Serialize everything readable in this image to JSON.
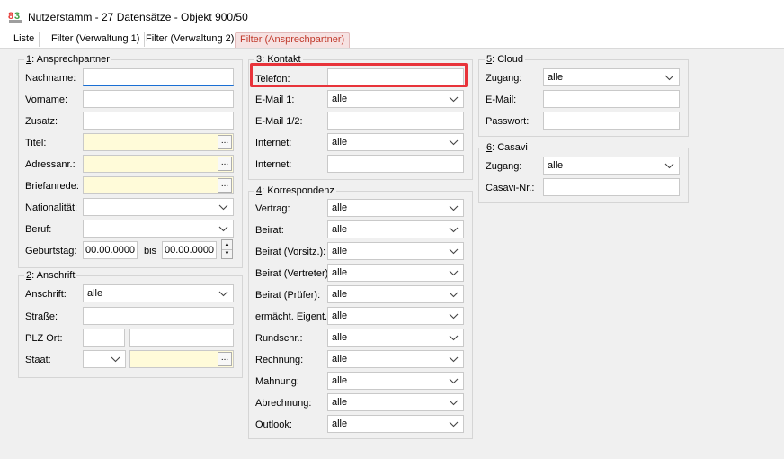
{
  "window": {
    "title": "Nutzerstamm - 27 Datensätze - Objekt 900/50"
  },
  "tabs": [
    {
      "label": "Liste"
    },
    {
      "label": "Filter (Verwaltung 1)"
    },
    {
      "label": "Filter (Verwaltung 2)"
    },
    {
      "label": "Filter (Ansprechpartner)"
    }
  ],
  "ansprechpartner": {
    "num": "1",
    "title": ": Ansprechpartner",
    "nachname": {
      "label": "Nachname:",
      "value": ""
    },
    "vorname": {
      "label": "Vorname:",
      "value": ""
    },
    "zusatz": {
      "label": "Zusatz:",
      "value": ""
    },
    "titel": {
      "label": "Titel:",
      "value": ""
    },
    "adressanr": {
      "label": "Adressanr.:",
      "value": ""
    },
    "briefanrede": {
      "label": "Briefanrede:",
      "value": ""
    },
    "nationalitaet": {
      "label": "Nationalität:",
      "value": ""
    },
    "beruf": {
      "label": "Beruf:",
      "value": ""
    },
    "geburtstag": {
      "label": "Geburtstag:",
      "from": "00.00.0000",
      "bis_label": "bis",
      "to": "00.00.0000"
    }
  },
  "anschrift": {
    "num": "2",
    "title": ": Anschrift",
    "anschrift": {
      "label": "Anschrift:",
      "value": "alle"
    },
    "strasse": {
      "label": "Straße:",
      "value": ""
    },
    "plz_ort": {
      "label": "PLZ Ort:",
      "plz": "",
      "ort": ""
    },
    "staat": {
      "label": "Staat:",
      "code": "",
      "name": ""
    }
  },
  "kontakt": {
    "num": "3",
    "title": ": Kontakt",
    "telefon": {
      "label": "Telefon:",
      "value": ""
    },
    "email1": {
      "label": "E-Mail 1:",
      "value": "alle"
    },
    "email12": {
      "label": "E-Mail 1/2:",
      "value": ""
    },
    "internet_combo": {
      "label": "Internet:",
      "value": "alle"
    },
    "internet_text": {
      "label": "Internet:",
      "value": ""
    }
  },
  "korrespondenz": {
    "num": "4",
    "title": ": Korrespondenz",
    "rows": [
      {
        "label": "Vertrag:",
        "value": "alle"
      },
      {
        "label": "Beirat:",
        "value": "alle"
      },
      {
        "label": "Beirat (Vorsitz.):",
        "value": "alle"
      },
      {
        "label": "Beirat (Vertreter):",
        "value": "alle"
      },
      {
        "label": "Beirat (Prüfer):",
        "value": "alle"
      },
      {
        "label": "ermächt. Eigent.:",
        "value": "alle"
      },
      {
        "label": "Rundschr.:",
        "value": "alle"
      },
      {
        "label": "Rechnung:",
        "value": "alle"
      },
      {
        "label": "Mahnung:",
        "value": "alle"
      },
      {
        "label": "Abrechnung:",
        "value": "alle"
      },
      {
        "label": "Outlook:",
        "value": "alle"
      }
    ]
  },
  "cloud": {
    "num": "5",
    "title": ": Cloud",
    "zugang": {
      "label": "Zugang:",
      "value": "alle"
    },
    "email": {
      "label": "E-Mail:",
      "value": ""
    },
    "passwort": {
      "label": "Passwort:",
      "value": ""
    }
  },
  "casavi": {
    "num": "6",
    "title": ": Casavi",
    "zugang": {
      "label": "Zugang:",
      "value": "alle"
    },
    "casavi_nr": {
      "label": "Casavi-Nr.:",
      "value": ""
    }
  },
  "icons": {
    "app": "app-logo-icon",
    "dropdown": "chevron-down-icon",
    "ellipsis": "ellipsis-icon",
    "spin_up": "spin-up-icon",
    "spin_down": "spin-down-icon"
  },
  "colors": {
    "highlight": "#e8333a",
    "yellow_field": "#fffbd9",
    "focus_underline": "#1a6fd4",
    "active_tab_text": "#c0392b"
  }
}
